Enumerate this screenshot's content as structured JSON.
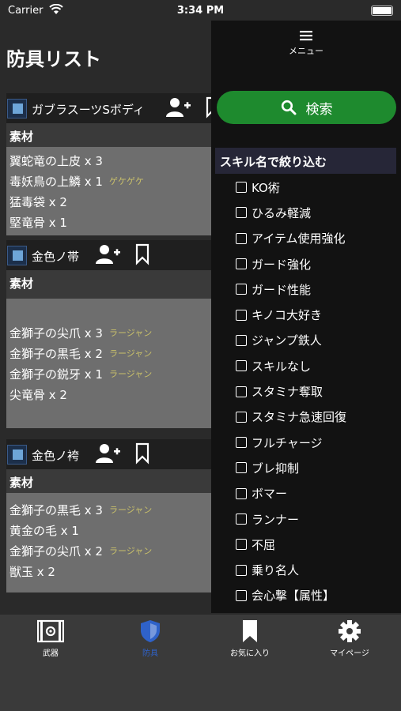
{
  "status_bar": {
    "carrier": "Carrier",
    "time": "3:34 PM"
  },
  "header": {
    "title": "防具リスト"
  },
  "armors": [
    {
      "name": "ガブラスーツSボディ",
      "section_label": "素材",
      "materials": [
        {
          "text": "翼蛇竜の上皮 x 3",
          "note": ""
        },
        {
          "text": "毒妖鳥の上鱗 x 1",
          "note": "ゲケゲケ"
        },
        {
          "text": "猛毒袋 x 2",
          "note": ""
        },
        {
          "text": "堅竜骨 x 1",
          "note": ""
        }
      ]
    },
    {
      "name": "金色ノ帯",
      "section_label": "素材",
      "materials": [
        {
          "text": "",
          "note": ""
        },
        {
          "text": "金獅子の尖爪 x 3",
          "note": "ラージャン"
        },
        {
          "text": "金獅子の黒毛 x 2",
          "note": "ラージャン"
        },
        {
          "text": "金獅子の鋭牙 x 1",
          "note": "ラージャン"
        },
        {
          "text": "尖竜骨 x 2",
          "note": ""
        },
        {
          "text": "",
          "note": ""
        }
      ]
    },
    {
      "name": "金色ノ袴",
      "section_label": "素材",
      "materials": [
        {
          "text": "金獅子の黒毛 x 3",
          "note": "ラージャン"
        },
        {
          "text": "黄金の毛 x 1",
          "note": ""
        },
        {
          "text": "金獅子の尖爪 x 2",
          "note": "ラージャン"
        },
        {
          "text": "獣玉 x 2",
          "note": ""
        }
      ]
    }
  ],
  "drawer": {
    "menu_label": "メニュー",
    "search_label": "検索",
    "filter_title": "スキル名で絞り込む",
    "skills": [
      "KO術",
      "ひるみ軽減",
      "アイテム使用強化",
      "ガード強化",
      "ガード性能",
      "キノコ大好き",
      "ジャンプ鉄人",
      "スキルなし",
      "スタミナ奪取",
      "スタミナ急速回復",
      "フルチャージ",
      "ブレ抑制",
      "ボマー",
      "ランナー",
      "不屈",
      "乗り名人",
      "会心撃【属性】"
    ]
  },
  "tabs": [
    {
      "label": "武器",
      "icon": "weapon-icon",
      "active": false
    },
    {
      "label": "防具",
      "icon": "shield-icon",
      "active": true
    },
    {
      "label": "お気に入り",
      "icon": "bookmark-icon",
      "active": false
    },
    {
      "label": "マイページ",
      "icon": "gear-icon",
      "active": false
    }
  ],
  "colors": {
    "accent_green": "#1e8a2e",
    "active_tab_blue": "#2f62c9",
    "note_yellow": "#c9c06a"
  }
}
